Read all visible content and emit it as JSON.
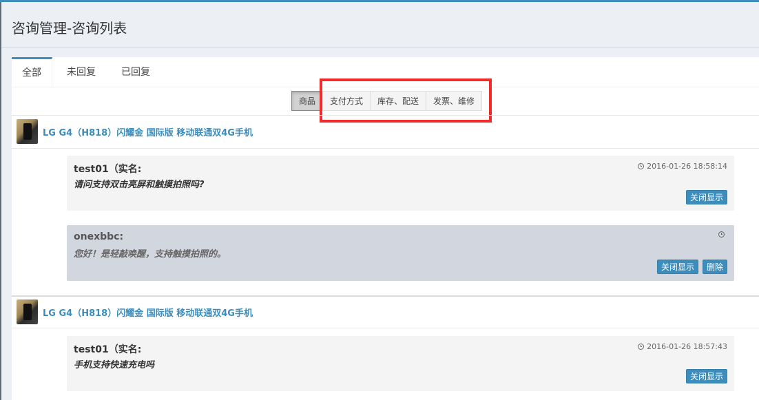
{
  "page": {
    "title": "咨询管理-咨询列表"
  },
  "tabs": [
    {
      "label": "全部",
      "active": true
    },
    {
      "label": "未回复",
      "active": false
    },
    {
      "label": "已回复",
      "active": false
    }
  ],
  "filters": [
    {
      "label": "商品",
      "active": true
    },
    {
      "label": "支付方式",
      "active": false
    },
    {
      "label": "库存、配送",
      "active": false
    },
    {
      "label": "发票、维修",
      "active": false
    }
  ],
  "items": [
    {
      "product": "LG G4（H818）闪耀金 国际版 移动联通双4G手机",
      "question": {
        "user": "test01（实名:",
        "text": "请问支持双击亮屏和触摸拍照吗?",
        "time": "2016-01-26 18:58:14",
        "action": "关闭显示"
      },
      "reply": {
        "user": "onexbbc:",
        "text": "您好！是轻敲唤醒，支持触摸拍照的。",
        "time": "",
        "action": "关闭显示",
        "delete": "删除"
      }
    },
    {
      "product": "LG G4（H818）闪耀金 国际版 移动联通双4G手机",
      "question": {
        "user": "test01（实名:",
        "text": "手机支持快速充电吗",
        "time": "2016-01-26 18:57:43",
        "action": "关闭显示"
      }
    }
  ],
  "colors": {
    "accent": "#3c8dbc",
    "highlight": "#ef2b2b",
    "question_bg": "#f4f4f4",
    "reply_bg": "#d2d6de"
  }
}
